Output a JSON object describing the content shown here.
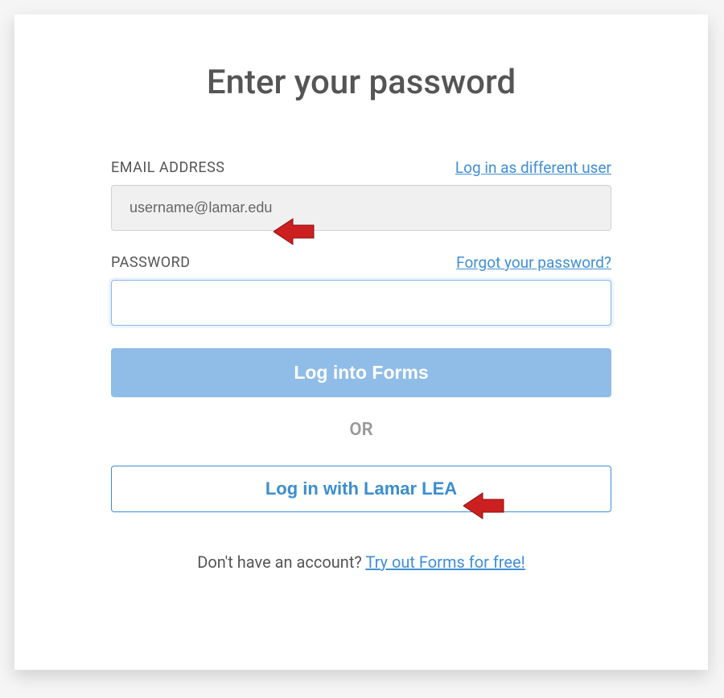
{
  "title": "Enter your password",
  "email": {
    "label": "EMAIL ADDRESS",
    "value": "username@lamar.edu",
    "switch_user_link": "Log in as different user"
  },
  "password": {
    "label": "PASSWORD",
    "forgot_link": "Forgot your password?"
  },
  "login_button": "Log into Forms",
  "divider_text": "OR",
  "sso_button": "Log in with Lamar LEA",
  "signup": {
    "prompt": "Don't have an account? ",
    "link": "Try out Forms for free!"
  },
  "annotations": {
    "arrow1": "pointer-arrow-icon",
    "arrow2": "pointer-arrow-icon"
  }
}
